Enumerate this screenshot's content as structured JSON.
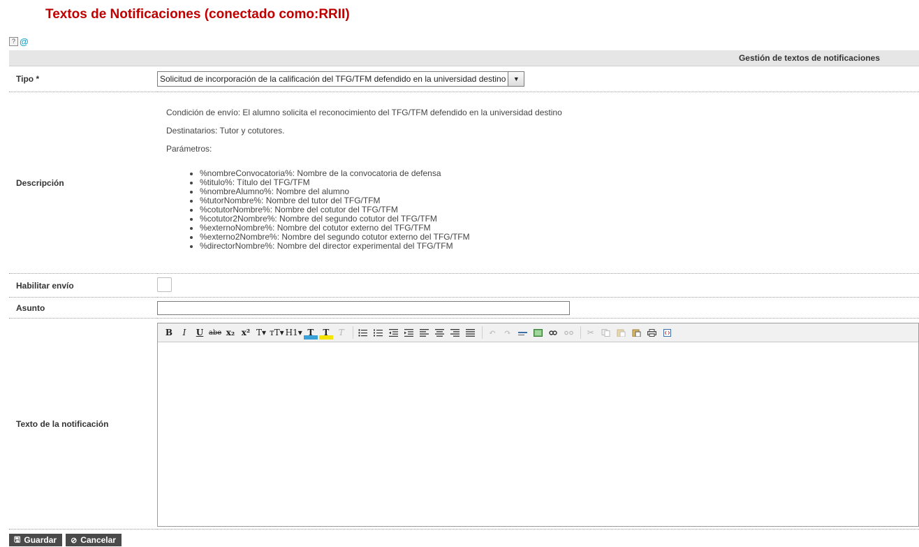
{
  "page": {
    "title": "Textos de Notificaciones (conectado como:RRII)",
    "help_label": "?"
  },
  "section": {
    "header": "Gestión de textos de notificaciones"
  },
  "form": {
    "tipo": {
      "label": "Tipo *",
      "value": "Solicitud de incorporación de la calificación del TFG/TFM defendido en la universidad destino"
    },
    "descripcion": {
      "label": "Descripción",
      "condicion": "Condición de envío: El alumno solicita el reconocimiento del TFG/TFM defendido en la universidad destino",
      "destinatarios": "Destinatarios: Tutor y cotutores.",
      "parametros_title": "Parámetros:",
      "parametros": [
        "%nombreConvocatoria%: Nombre de la convocatoria de defensa",
        "%titulo%: Título del TFG/TFM",
        "%nombreAlumno%: Nombre del alumno",
        "%tutorNombre%: Nombre del tutor del TFG/TFM",
        "%cotutorNombre%: Nombre del cotutor del TFG/TFM",
        "%cotutor2Nombre%: Nombre del segundo cotutor del TFG/TFM",
        "%externoNombre%: Nombre del cotutor externo del TFG/TFM",
        "%externo2Nombre%: Nombre del segundo cotutor externo del TFG/TFM",
        "%directorNombre%: Nombre del director experimental del TFG/TFM"
      ]
    },
    "habilitar": {
      "label": "Habilitar envío",
      "checked": false
    },
    "asunto": {
      "label": "Asunto",
      "value": ""
    },
    "texto": {
      "label": "Texto de la notificación",
      "value": ""
    }
  },
  "toolbar": {
    "bold": "B",
    "italic": "I",
    "underline": "U",
    "strike": "abe",
    "subscript": "x₂",
    "superscript": "x²",
    "font_size": "T▾",
    "font_family": "тT▾",
    "heading": "H1▾",
    "text_color": "T",
    "highlight": "T",
    "clear_format": "T"
  },
  "buttons": {
    "save": "Guardar",
    "cancel": "Cancelar"
  }
}
